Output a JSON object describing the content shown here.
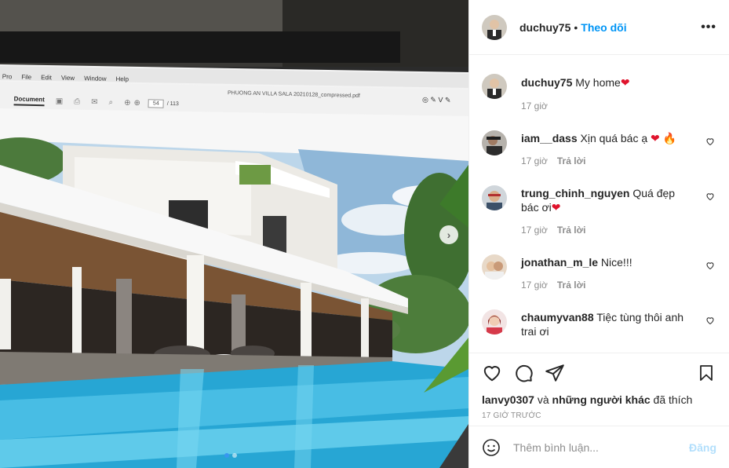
{
  "post": {
    "author": "duchuy75",
    "follow_label": "Theo dõi",
    "separator": "•",
    "more_label": "•••"
  },
  "caption": {
    "username": "duchuy75",
    "text": "My home",
    "emoji": "❤",
    "time": "17 giờ"
  },
  "comments": [
    {
      "username": "iam__dass",
      "text": "Xịn quá bác ạ",
      "emoji1": "❤",
      "emoji2": "🔥",
      "time": "17 giờ",
      "reply_label": "Trả lời"
    },
    {
      "username": "trung_chinh_nguyen",
      "text": "Quá đẹp bác ơi",
      "emoji1": "❤",
      "time": "17 giờ",
      "reply_label": "Trả lời"
    },
    {
      "username": "jonathan_m_le",
      "text": "Nice!!!",
      "time": "17 giờ",
      "reply_label": "Trả lời"
    },
    {
      "username": "chaumyvan88",
      "text": "Tiệc tùng thôi anh trai ơi"
    }
  ],
  "likes": {
    "first_user": "lanvy0307",
    "connector": "và",
    "others_label": "những người khác",
    "suffix": "đã thích"
  },
  "timestamp": "17 GIỜ TRƯỚC",
  "add_comment": {
    "placeholder": "Thêm bình luận...",
    "post_label": "Đăng"
  },
  "photo": {
    "menu": [
      "Pro",
      "File",
      "Edit",
      "View",
      "Window",
      "Help"
    ],
    "document_tab": "Document",
    "filename": "PHUONG AN VILLA SALA 20210128_compressed.pdf",
    "page_current": "54",
    "page_total": "/ 113",
    "next_arrow": "›",
    "carousel_count": 2,
    "carousel_active": 1
  },
  "colors": {
    "link_blue": "#0095f6",
    "muted": "#8e8e8e",
    "heart_red": "#e0142d",
    "post_disabled": "#b2dffc"
  }
}
